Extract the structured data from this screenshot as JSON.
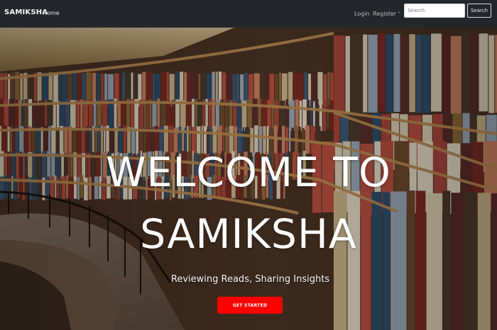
{
  "navbar": {
    "brand": "SAMIKSHA",
    "home_label": "Home",
    "login_label": "Login",
    "register_label": "Register",
    "search_placeholder": "Search",
    "search_button_label": "Search"
  },
  "hero": {
    "title_line1": "WELCOME TO",
    "title_line2": "SAMIKSHA",
    "subtitle": "Reviewing Reads, Sharing Insights",
    "cta_label": "GET STARTED"
  },
  "colors": {
    "navbar_bg": "#23272b",
    "cta_bg": "#ff0000",
    "text_light": "#ffffff"
  }
}
